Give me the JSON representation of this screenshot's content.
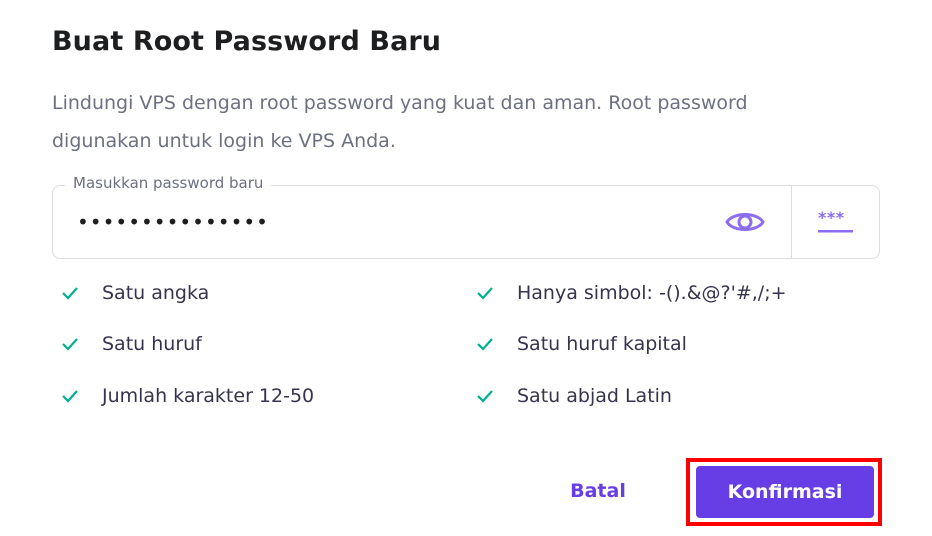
{
  "dialog": {
    "title": "Buat Root Password Baru",
    "description": "Lindungi VPS dengan root password yang kuat dan aman. Root password digunakan untuk login ke VPS Anda."
  },
  "password_field": {
    "label": "Masukkan password baru",
    "value": "•••••••••••••••",
    "show_icon": "eye-icon",
    "generate_icon": "generate-password-icon"
  },
  "requirements": {
    "left": [
      {
        "label": "Satu angka",
        "met": true
      },
      {
        "label": "Satu huruf",
        "met": true
      },
      {
        "label": "Jumlah karakter 12-50",
        "met": true
      }
    ],
    "right": [
      {
        "label": "Hanya simbol: -().&@?'#,/;+",
        "met": true
      },
      {
        "label": "Satu huruf kapital",
        "met": true
      },
      {
        "label": "Satu abjad Latin",
        "met": true
      }
    ]
  },
  "actions": {
    "cancel_label": "Batal",
    "confirm_label": "Konfirmasi"
  },
  "colors": {
    "accent": "#673de6",
    "check": "#00b090",
    "highlight": "#ff0000"
  }
}
